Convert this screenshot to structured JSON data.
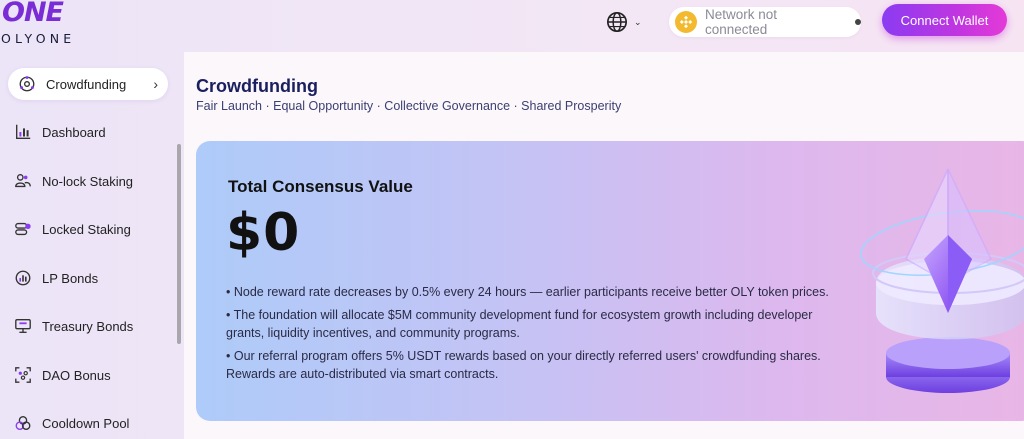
{
  "brand": {
    "logo_mark": "ONE",
    "logo_text": "OLYONE"
  },
  "header": {
    "network_status": "Network not connected",
    "connect_label": "Connect Wallet"
  },
  "sidebar": {
    "items": [
      {
        "label": "Crowdfunding",
        "icon": "crowdfunding-icon",
        "active": true
      },
      {
        "label": "Dashboard",
        "icon": "dashboard-icon"
      },
      {
        "label": "No-lock Staking",
        "icon": "no-lock-staking-icon"
      },
      {
        "label": "Locked Staking",
        "icon": "locked-staking-icon"
      },
      {
        "label": "LP Bonds",
        "icon": "lp-bonds-icon"
      },
      {
        "label": "Treasury Bonds",
        "icon": "treasury-bonds-icon"
      },
      {
        "label": "DAO Bonus",
        "icon": "dao-bonus-icon"
      },
      {
        "label": "Cooldown Pool",
        "icon": "cooldown-pool-icon"
      }
    ]
  },
  "main": {
    "title": "Crowdfunding",
    "subtitle": "Fair Launch · Equal Opportunity · Collective Governance · Shared Prosperity",
    "card": {
      "title": "Total Consensus Value",
      "value": "$0",
      "bullets": [
        "• Node reward rate decreases by 0.5% every 24 hours — earlier participants receive better OLY token prices.",
        "• The foundation will allocate $5M community development fund for ecosystem growth including developer grants, liquidity incentives, and community programs.",
        "• Our referral program offers 5% USDT rewards based on your directly referred users' crowdfunding shares. Rewards are auto-distributed via smart contracts."
      ]
    }
  },
  "colors": {
    "accent": "#8b3bf2",
    "accent_pink": "#e43ad8",
    "title_navy": "#1a1f5e",
    "bnb_yellow": "#f3ba2f"
  }
}
